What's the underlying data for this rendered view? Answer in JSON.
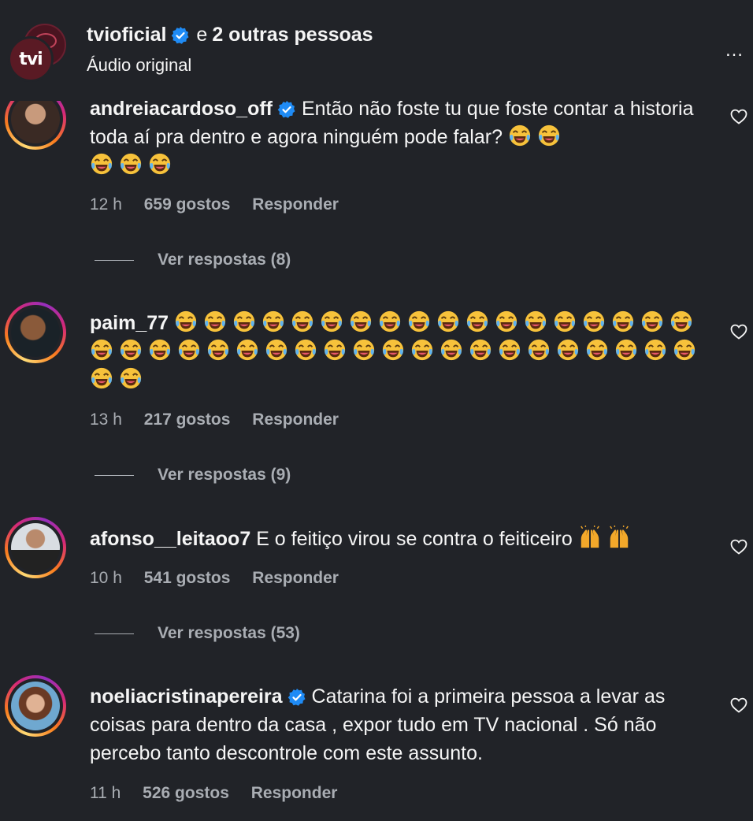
{
  "header": {
    "account": "tvioficial",
    "connector": "e",
    "others": "2 outras pessoas",
    "subtitle": "Áudio original",
    "logo_text": "tvi",
    "more_icon": "…"
  },
  "comments": [
    {
      "username": "andreiacardoso_off",
      "verified": true,
      "text": "Então não foste tu que foste contar a historia toda aí pra dentro e agora ninguém pode falar?",
      "emojis": "😂 😂 😂 😂 😂",
      "time": "12 h",
      "likes": "659 gostos",
      "reply": "Responder",
      "view_replies": "Ver respostas (8)"
    },
    {
      "username": "paim_77",
      "verified": false,
      "emojis": "😂😂😂😂😂😂😂😂😂😂😂😂😂😂😂😂😂😂😂😂😂😂😂😂😂😂😂😂😂😂😂😂😂😂😂😂😂😂😂😂😂",
      "time": "13 h",
      "likes": "217 gostos",
      "reply": "Responder",
      "view_replies": "Ver respostas (9)"
    },
    {
      "username": "afonso__leitaoo7",
      "verified": false,
      "text": "E o feitiço virou se contra o feiticeiro",
      "emojis": "🙌 🙌",
      "time": "10 h",
      "likes": "541 gostos",
      "reply": "Responder",
      "view_replies": "Ver respostas (53)"
    },
    {
      "username": "noeliacristinapereira",
      "verified": true,
      "text": "Catarina foi a primeira pessoa a levar as coisas para dentro da casa , expor tudo em TV nacional . Só não percebo tanto descontrole com este assunto.",
      "time": "11 h",
      "likes": "526 gostos",
      "reply": "Responder"
    }
  ],
  "colors": {
    "background": "#212328",
    "text": "#f5f5f5",
    "muted": "#a9adb3",
    "verified": "#1f8bf5"
  }
}
